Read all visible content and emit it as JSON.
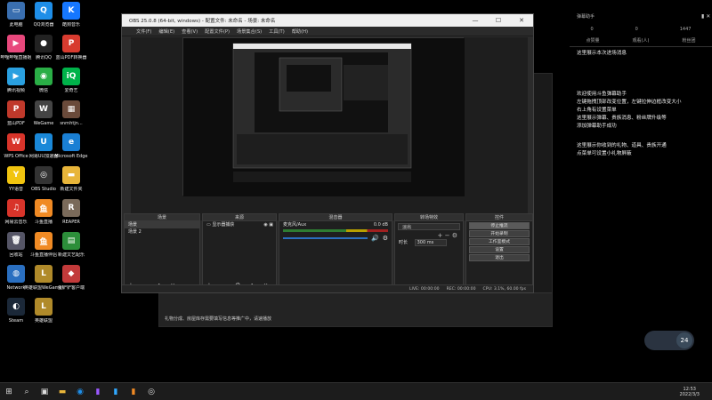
{
  "desktop": {
    "icons": [
      {
        "label": "此电脑",
        "color": "#3a6fb0",
        "glyph": "▭"
      },
      {
        "label": "QQ浏览器",
        "color": "#1e8ee8",
        "glyph": "Q"
      },
      {
        "label": "酷狗音乐",
        "color": "#1677ff",
        "glyph": "K"
      },
      {
        "label": "哔哩哔哩直播姬",
        "color": "#e8487c",
        "glyph": "▶"
      },
      {
        "label": "腾讯QQ",
        "color": "#222",
        "glyph": "●"
      },
      {
        "label": "蓝山PDF转换器",
        "color": "#d83b2f",
        "glyph": "P"
      },
      {
        "label": "腾讯视频",
        "color": "#2aa0e0",
        "glyph": "▶"
      },
      {
        "label": "微信",
        "color": "#2aae46",
        "glyph": "◉"
      },
      {
        "label": "爱奇艺",
        "color": "#00b34a",
        "glyph": "iQ"
      },
      {
        "label": "蓝山PDF",
        "color": "#c0392b",
        "glyph": "P"
      },
      {
        "label": "WeGame",
        "color": "#444",
        "glyph": "W"
      },
      {
        "label": "snrnhtjn...",
        "color": "#6a4a3a",
        "glyph": "▦"
      },
      {
        "label": "WPS Office",
        "color": "#d8342a",
        "glyph": "W"
      },
      {
        "label": "网易UU加速器",
        "color": "#1a88d8",
        "glyph": "U"
      },
      {
        "label": "Microsoft Edge",
        "color": "#1a7fd4",
        "glyph": "e"
      },
      {
        "label": "YY语音",
        "color": "#f1c40f",
        "glyph": "Y"
      },
      {
        "label": "OBS Studio",
        "color": "#333",
        "glyph": "◎"
      },
      {
        "label": "新建文件夹",
        "color": "#e8b53a",
        "glyph": "▬"
      },
      {
        "label": "网易云音乐",
        "color": "#d8342a",
        "glyph": "♫"
      },
      {
        "label": "斗鱼直播",
        "color": "#f08a24",
        "glyph": "鱼"
      },
      {
        "label": "REAPER",
        "color": "#7a6a5a",
        "glyph": "R"
      },
      {
        "label": "回收站",
        "color": "#556",
        "glyph": "🗑"
      },
      {
        "label": "斗鱼直播伴侣",
        "color": "#f08a24",
        "glyph": "鱼"
      },
      {
        "label": "新建文艺配乐",
        "color": "#2c8e3a",
        "glyph": "▤"
      },
      {
        "label": "Network",
        "color": "#2a6fc0",
        "glyph": "◍"
      },
      {
        "label": "英雄联盟WeGame版",
        "color": "#b08a2a",
        "glyph": "L"
      },
      {
        "label": "金铲铲客户端",
        "color": "#c23a3a",
        "glyph": "◆"
      },
      {
        "label": "Steam",
        "color": "#1b2838",
        "glyph": "◐"
      },
      {
        "label": "英雄联盟",
        "color": "#b08a2a",
        "glyph": "L"
      }
    ]
  },
  "obs": {
    "title": "OBS 25.0.8 (64-bit, windows) - 配置文件: 未命名 - 场景: 未命名",
    "menu": [
      "文件(F)",
      "编辑(E)",
      "查看(V)",
      "配置文件(P)",
      "场景集合(S)",
      "工具(T)",
      "帮助(H)"
    ],
    "window_controls": [
      "—",
      "☐",
      "✕"
    ],
    "docks": {
      "scenes": {
        "title": "场景",
        "items": [
          "场景",
          "场景 2"
        ],
        "footer": "+ − ∧ ∨"
      },
      "sources": {
        "title": "来源",
        "items": [
          "显示器捕获"
        ],
        "footer": "+ − ⚙ ∧ ∨"
      },
      "mixer": {
        "title": "混音器",
        "channel": "麦克风/Aux",
        "level": "0.0 dB"
      },
      "transitions": {
        "title": "转场特效",
        "type": "淡出",
        "duration_label": "时长",
        "duration_value": "300 ms"
      },
      "controls": {
        "title": "控件",
        "buttons": [
          "停止推流",
          "开始录制",
          "工作室模式",
          "设置",
          "退出"
        ]
      }
    },
    "status": {
      "live": "LIVE: 00:00:00",
      "rec": "REC: 00:00:00",
      "cpu": "CPU: 3.1%, 60.00 fps"
    }
  },
  "live_app": {
    "warning": "礼物分成、房屋库存需要填写信息等推广中，请速播放"
  },
  "right_panel": {
    "header": [
      "弹幕助手"
    ],
    "stats": [
      "点赞量",
      "观看(人)",
      "粉丝团"
    ],
    "stat_values": [
      "0",
      "0",
      "1447"
    ],
    "line1": "这里展示本次进场消息",
    "block2": [
      "欢迎使用斗鱼弹幕助手",
      "左键拖拽顶部改变位置，左键拉伸边框改变大小",
      "右上角有设置菜单",
      "这里展示弹幕、贵族消息、粉丝牌升级等",
      "添加弹幕助手成功"
    ],
    "block3": [
      "这里展示你收到的礼物、道具、贵族开通",
      "点菜单可设置小礼物屏蔽"
    ]
  },
  "taskbar": {
    "time": "12:53",
    "date": "2022/3/3",
    "widget_value": "24"
  }
}
